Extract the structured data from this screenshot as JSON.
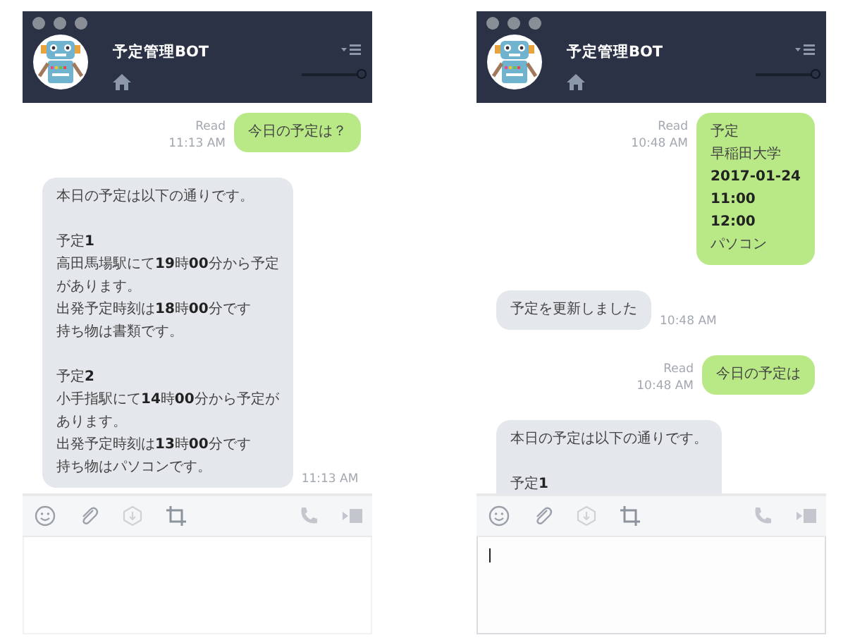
{
  "windows": [
    {
      "title": "予定管理BOT",
      "opacity_slider": {
        "level": 1
      },
      "input": {
        "focused": false
      },
      "messages": [
        {
          "kind": "sent",
          "read": "Read",
          "time": "11:13 AM",
          "paragraphs": [
            [
              "今日の予定は？"
            ]
          ]
        },
        {
          "kind": "received",
          "time": "11:13 AM",
          "paragraphs": [
            [
              "本日の予定は以下の通りです。"
            ],
            [
              "予定**1**",
              "高田馬場駅にて**19**時**00**分から予定",
              "があります。",
              "出発予定時刻は**18**時**00**分です",
              "持ち物は書類です。"
            ],
            [
              "予定**2**",
              "小手指駅にて**14**時**00**分から予定が",
              "あります。",
              "出発予定時刻は**13**時**00**分です",
              "持ち物はパソコンです。"
            ]
          ]
        }
      ]
    },
    {
      "title": "予定管理BOT",
      "opacity_slider": {
        "level": 1
      },
      "input": {
        "focused": true
      },
      "messages": [
        {
          "kind": "sent",
          "read": "Read",
          "time": "10:48 AM",
          "paragraphs": [
            [
              "予定",
              "早稲田大学",
              "**2017-01-24**",
              "**11:00**",
              "**12:00**",
              "パソコン"
            ]
          ]
        },
        {
          "kind": "received",
          "time": "10:48 AM",
          "paragraphs": [
            [
              "予定を更新しました"
            ]
          ]
        },
        {
          "kind": "sent",
          "read": "Read",
          "time": "10:48 AM",
          "paragraphs": [
            [
              "今日の予定は"
            ]
          ]
        },
        {
          "kind": "received",
          "paragraphs": [
            [
              "本日の予定は以下の通りです。"
            ],
            [
              "予定**1**"
            ]
          ],
          "cut": true
        }
      ]
    }
  ]
}
